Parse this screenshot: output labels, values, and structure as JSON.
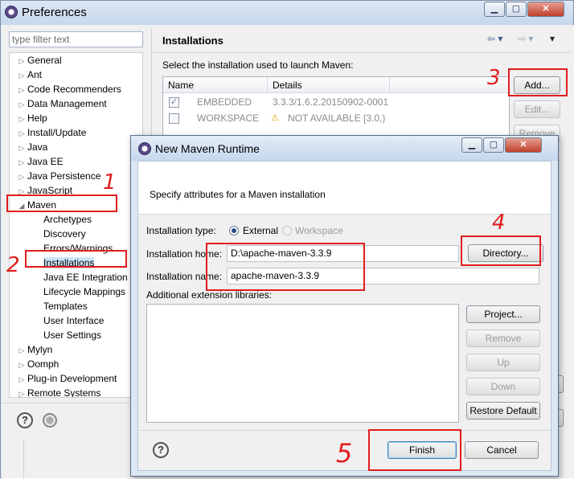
{
  "preferences": {
    "title": "Preferences",
    "filter_placeholder": "type filter text",
    "tree": [
      {
        "label": "General",
        "arrow": "▷",
        "indent": 0
      },
      {
        "label": "Ant",
        "arrow": "▷",
        "indent": 0
      },
      {
        "label": "Code Recommenders",
        "arrow": "▷",
        "indent": 0
      },
      {
        "label": "Data Management",
        "arrow": "▷",
        "indent": 0
      },
      {
        "label": "Help",
        "arrow": "▷",
        "indent": 0
      },
      {
        "label": "Install/Update",
        "arrow": "▷",
        "indent": 0
      },
      {
        "label": "Java",
        "arrow": "▷",
        "indent": 0
      },
      {
        "label": "Java EE",
        "arrow": "▷",
        "indent": 0
      },
      {
        "label": "Java Persistence",
        "arrow": "▷",
        "indent": 0
      },
      {
        "label": "JavaScript",
        "arrow": "▷",
        "indent": 0
      },
      {
        "label": "Maven",
        "arrow": "◢",
        "indent": 0
      },
      {
        "label": "Archetypes",
        "arrow": "",
        "indent": 1
      },
      {
        "label": "Discovery",
        "arrow": "",
        "indent": 1
      },
      {
        "label": "Errors/Warnings",
        "arrow": "",
        "indent": 1
      },
      {
        "label": "Installations",
        "arrow": "",
        "indent": 1,
        "selected": true
      },
      {
        "label": "Java EE Integration",
        "arrow": "",
        "indent": 1
      },
      {
        "label": "Lifecycle Mappings",
        "arrow": "",
        "indent": 1
      },
      {
        "label": "Templates",
        "arrow": "",
        "indent": 1
      },
      {
        "label": "User Interface",
        "arrow": "",
        "indent": 1
      },
      {
        "label": "User Settings",
        "arrow": "",
        "indent": 1
      },
      {
        "label": "Mylyn",
        "arrow": "▷",
        "indent": 0
      },
      {
        "label": "Oomph",
        "arrow": "▷",
        "indent": 0
      },
      {
        "label": "Plug-in Development",
        "arrow": "▷",
        "indent": 0
      },
      {
        "label": "Remote Systems",
        "arrow": "▷",
        "indent": 0
      }
    ],
    "section_title": "Installations",
    "instruction": "Select the installation used to launch Maven:",
    "table": {
      "columns": [
        "Name",
        "Details"
      ],
      "rows": [
        {
          "checked": true,
          "name": "EMBEDDED",
          "details": "3.3.3/1.6.2.20150902-0001",
          "warning": false
        },
        {
          "checked": false,
          "name": "WORKSPACE",
          "details": "NOT AVAILABLE [3.0,)",
          "warning": true
        }
      ]
    },
    "buttons": {
      "add": "Add...",
      "edit": "Edit...",
      "remove": "Remove"
    },
    "help_symbol": "?"
  },
  "dialog": {
    "title": "New Maven Runtime",
    "description": "Specify attributes for a Maven installation",
    "installation_type_label": "Installation type:",
    "type_external": "External",
    "type_workspace": "Workspace",
    "installation_home_label": "Installation home:",
    "installation_home_value": "D:\\apache-maven-3.3.9",
    "installation_name_label": "Installation name:",
    "installation_name_value": "apache-maven-3.3.9",
    "extension_libraries_label": "Additional extension libraries:",
    "buttons": {
      "directory": "Directory...",
      "project": "Project...",
      "remove": "Remove",
      "up": "Up",
      "down": "Down",
      "restore_default": "Restore Default",
      "finish": "Finish",
      "cancel": "Cancel"
    },
    "help_symbol": "?"
  },
  "annotations": [
    "1",
    "2",
    "3",
    "4",
    "5"
  ],
  "colors": {
    "annotation": "#e11c1c",
    "selection": "#cde6fb"
  }
}
